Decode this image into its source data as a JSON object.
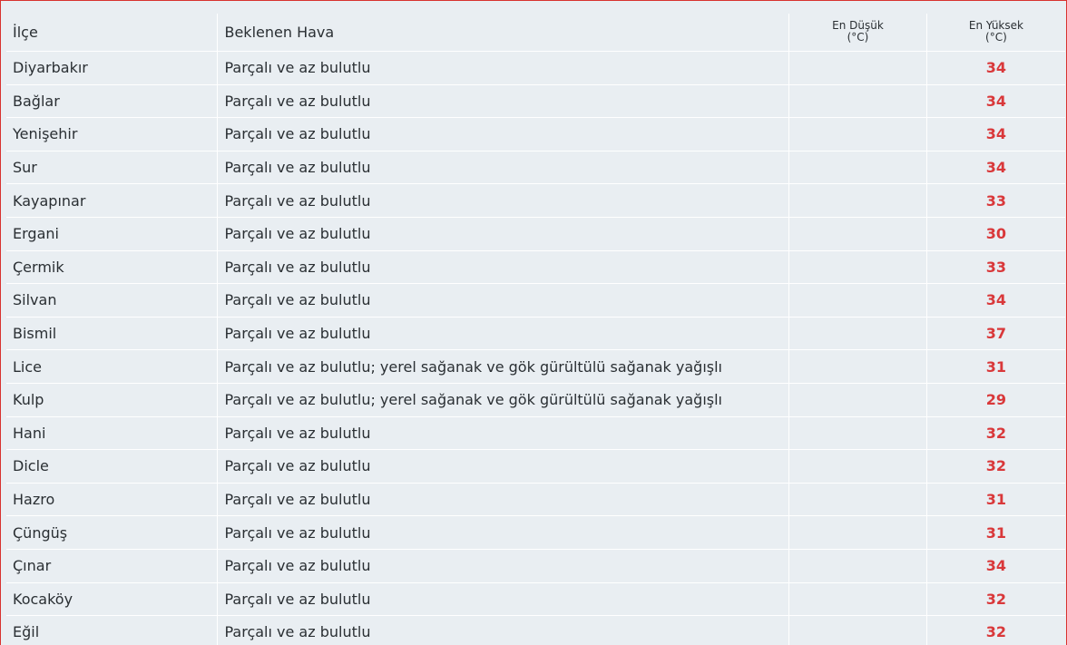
{
  "table": {
    "headers": {
      "district": "İlçe",
      "weather": "Beklenen Hava",
      "min_line1": "En Düşük",
      "min_line2": "(°C)",
      "max_line1": "En Yüksek",
      "max_line2": "(°C)"
    },
    "rows": [
      {
        "district": "Diyarbakır",
        "weather": "Parçalı ve az bulutlu",
        "min": "",
        "max": "34"
      },
      {
        "district": "Bağlar",
        "weather": "Parçalı ve az bulutlu",
        "min": "",
        "max": "34"
      },
      {
        "district": "Yenişehir",
        "weather": "Parçalı ve az bulutlu",
        "min": "",
        "max": "34"
      },
      {
        "district": "Sur",
        "weather": "Parçalı ve az bulutlu",
        "min": "",
        "max": "34"
      },
      {
        "district": "Kayapınar",
        "weather": "Parçalı ve az bulutlu",
        "min": "",
        "max": "33"
      },
      {
        "district": "Ergani",
        "weather": "Parçalı ve az bulutlu",
        "min": "",
        "max": "30"
      },
      {
        "district": "Çermik",
        "weather": "Parçalı ve az bulutlu",
        "min": "",
        "max": "33"
      },
      {
        "district": "Silvan",
        "weather": "Parçalı ve az bulutlu",
        "min": "",
        "max": "34"
      },
      {
        "district": "Bismil",
        "weather": "Parçalı ve az bulutlu",
        "min": "",
        "max": "37"
      },
      {
        "district": "Lice",
        "weather": "Parçalı ve az bulutlu; yerel sağanak ve gök gürültülü sağanak yağışlı",
        "min": "",
        "max": "31"
      },
      {
        "district": "Kulp",
        "weather": "Parçalı ve az bulutlu; yerel sağanak ve gök gürültülü sağanak yağışlı",
        "min": "",
        "max": "29"
      },
      {
        "district": "Hani",
        "weather": "Parçalı ve az bulutlu",
        "min": "",
        "max": "32"
      },
      {
        "district": "Dicle",
        "weather": "Parçalı ve az bulutlu",
        "min": "",
        "max": "32"
      },
      {
        "district": "Hazro",
        "weather": "Parçalı ve az bulutlu",
        "min": "",
        "max": "31"
      },
      {
        "district": "Çüngüş",
        "weather": "Parçalı ve az bulutlu",
        "min": "",
        "max": "31"
      },
      {
        "district": "Çınar",
        "weather": "Parçalı ve az bulutlu",
        "min": "",
        "max": "34"
      },
      {
        "district": "Kocaköy",
        "weather": "Parçalı ve az bulutlu",
        "min": "",
        "max": "32"
      },
      {
        "district": "Eğil",
        "weather": "Parçalı ve az bulutlu",
        "min": "",
        "max": "32"
      }
    ]
  },
  "colors": {
    "background": "#e9eef2",
    "max_temp": "#d9383a",
    "frame_border": "#d8322f"
  }
}
